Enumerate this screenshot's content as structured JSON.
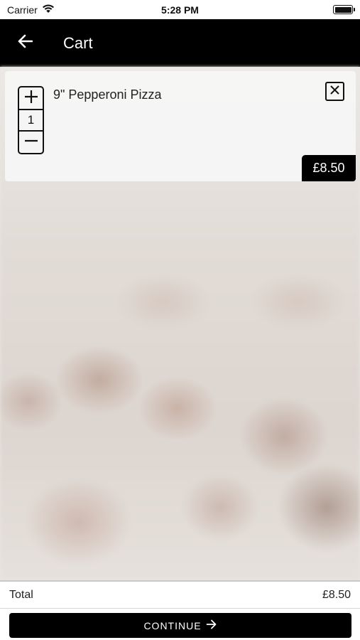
{
  "status_bar": {
    "carrier": "Carrier",
    "time": "5:28 PM"
  },
  "header": {
    "title": "Cart",
    "back_icon": "arrow-left-icon"
  },
  "cart": {
    "items": [
      {
        "name": "9\" Pepperoni Pizza",
        "quantity": "1",
        "price": "£8.50"
      }
    ]
  },
  "footer": {
    "total_label": "Total",
    "total_value": "£8.50",
    "continue_label": "CONTINUE",
    "continue_icon": "arrow-right-icon"
  },
  "colors": {
    "header_bg": "#000000",
    "button_bg": "#000000",
    "card_bg": "#f6f6f6"
  }
}
